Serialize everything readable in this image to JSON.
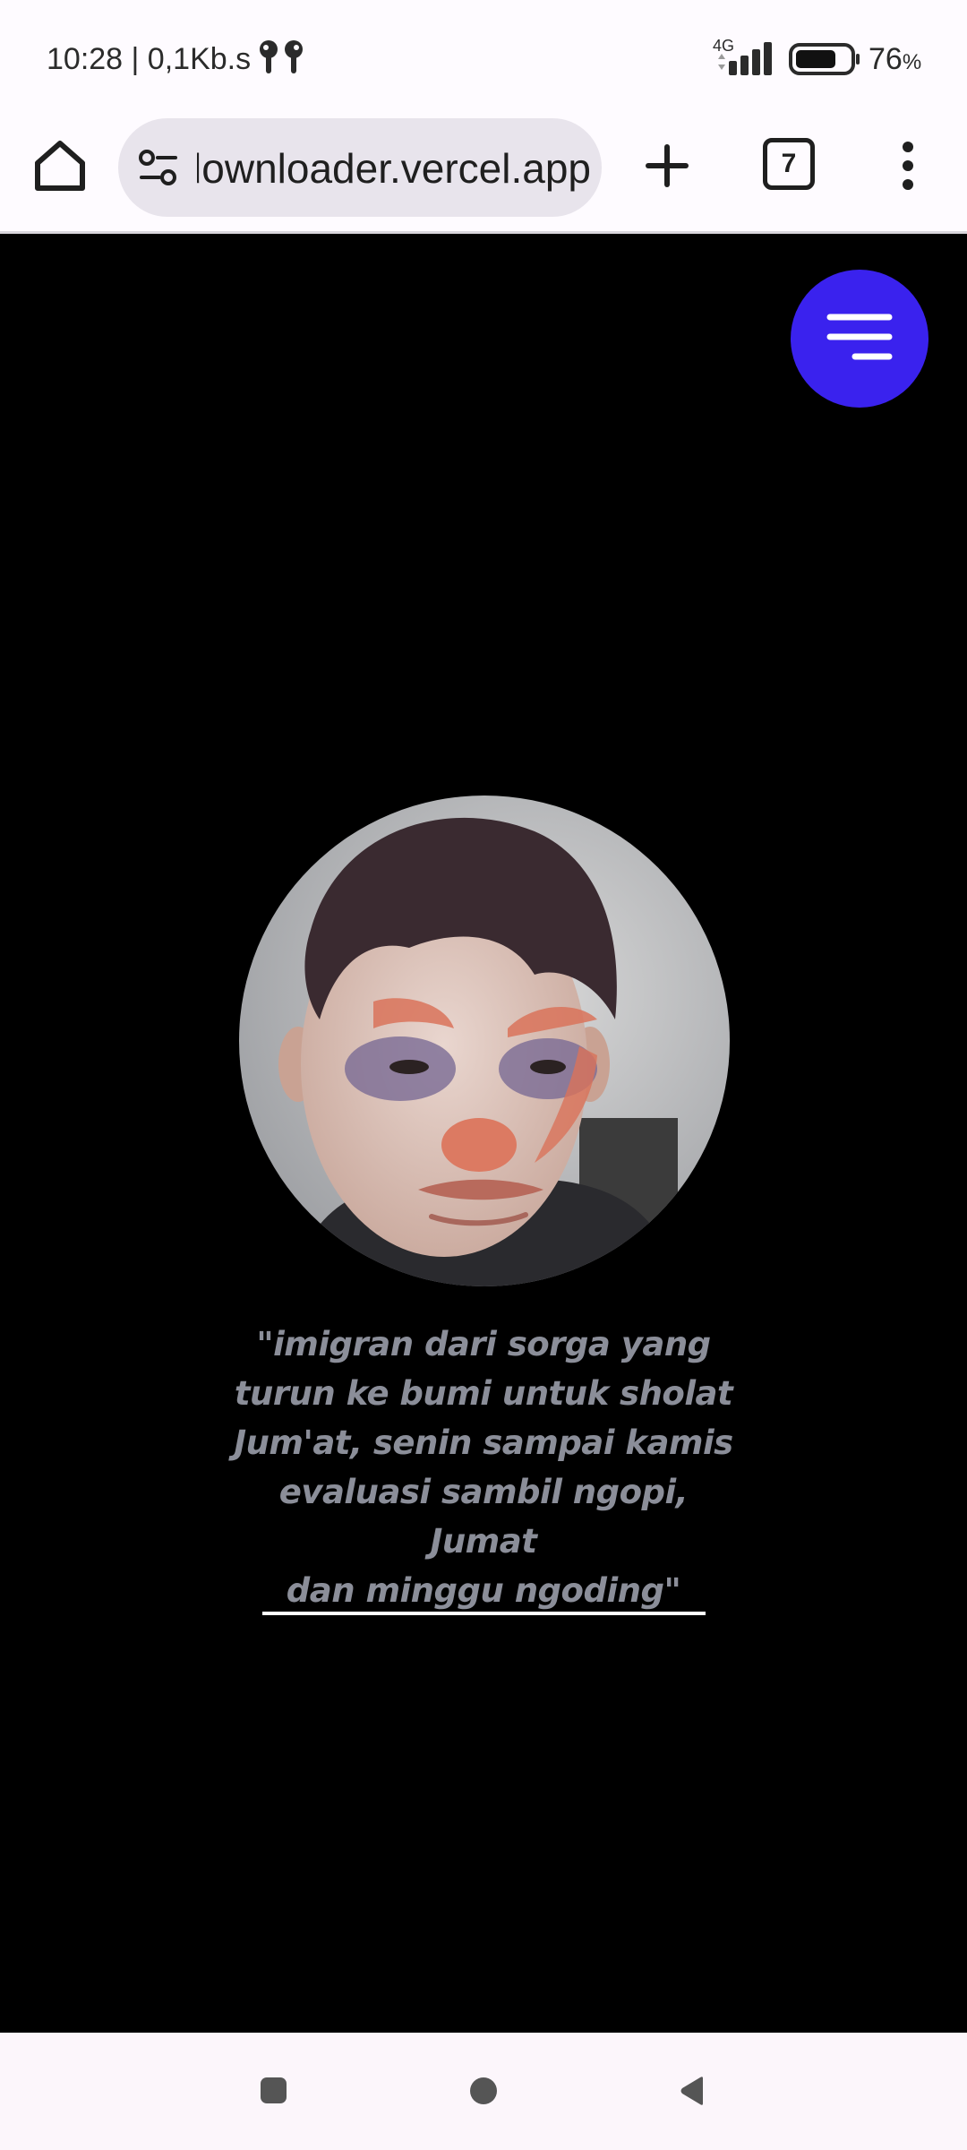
{
  "status_bar": {
    "time_speed": "10:28 | 0,1Kb.s",
    "network_type": "4G",
    "battery_percent": "76",
    "battery_percent_sign": "%",
    "battery_fraction": 0.76,
    "icons": [
      "earbuds-icon",
      "signal-icon",
      "battery-icon"
    ]
  },
  "browser": {
    "url": "youtube-downloader.vercel.app",
    "tab_count": "7",
    "icons": [
      "home-icon",
      "site-settings-icon",
      "plus-icon",
      "tab-switcher-icon",
      "more-vert-icon"
    ]
  },
  "page": {
    "menu_button_icon": "hamburger-icon",
    "accent_color": "#3a22ee",
    "quote_color": "#8b8e99",
    "quote_lines": [
      "\"imigran dari sorga yang",
      "turun ke bumi untuk sholat",
      "Jum'at, senin sampai kamis",
      "evaluasi sambil ngopi, Jumat",
      "dan minggu ngoding\""
    ]
  },
  "nav_bar": {
    "icons": [
      "recents-icon",
      "home-circle-icon",
      "back-triangle-icon"
    ]
  }
}
